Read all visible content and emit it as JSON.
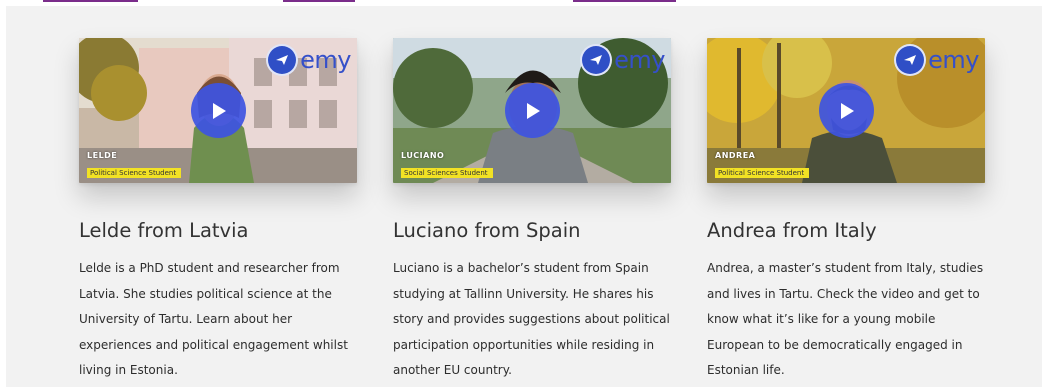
{
  "cards": [
    {
      "title": "Lelde from Latvia",
      "caption_name": "LELDE",
      "caption_role": "Political Science Student",
      "description": "Lelde is a PhD student and researcher from Latvia. She studies political science at the University of Tartu. Learn about her experiences and political engagement whilst living in Estonia."
    },
    {
      "title": "Luciano from Spain",
      "caption_name": "LUCIANO",
      "caption_role": "Social Sciences Student",
      "description": "Luciano is a bachelor’s student from Spain studying at Tallinn University. He shares his story and provides suggestions about political participation opportunities while residing in another EU country."
    },
    {
      "title": "Andrea from Italy",
      "caption_name": "ANDREA",
      "caption_role": "Political Science Student",
      "description": "Andrea, a master’s student from Italy, studies and lives in Tartu. Check the video and get to know what it’s like for a young mobile European to be democratically engaged in Estonian life."
    }
  ],
  "logo_text": "emy",
  "icons": {
    "play": "play-icon",
    "logo": "emy-logo-icon"
  },
  "colors": {
    "play_button": "#3d54e2",
    "caption_bar": "#f2e224",
    "link": "#7b2d8b",
    "panel_bg": "#f2f2f2"
  }
}
